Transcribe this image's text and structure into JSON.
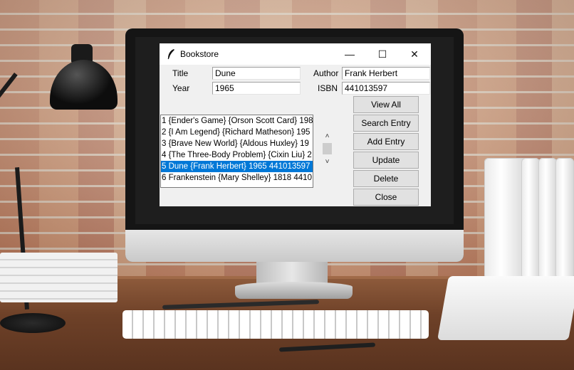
{
  "window": {
    "title": "Bookstore",
    "min_glyph": "—",
    "max_glyph": "☐",
    "close_glyph": "✕"
  },
  "form": {
    "title_label": "Title",
    "title_value": "Dune",
    "author_label": "Author",
    "author_value": "Frank Herbert",
    "year_label": "Year",
    "year_value": "1965",
    "isbn_label": "ISBN",
    "isbn_value": "441013597"
  },
  "list": {
    "items": [
      "1 {Ender's Game} {Orson Scott Card} 198",
      "2 {I Am Legend} {Richard Matheson} 195",
      "3 {Brave New World} {Aldous Huxley} 19",
      "4 {The Three-Body Problem} {Cixin Liu} 2",
      "5 Dune {Frank Herbert} 1965 441013597",
      "6 Frankenstein {Mary Shelley} 1818 4410"
    ],
    "selected_index": 4
  },
  "scrollbar": {
    "up_glyph": "˄",
    "down_glyph": "˅"
  },
  "buttons": {
    "view_all": "View All",
    "search": "Search Entry",
    "add": "Add Entry",
    "update": "Update",
    "delete": "Delete",
    "close": "Close"
  },
  "colors": {
    "selection": "#0078d7",
    "window_bg": "#f0f0f0"
  }
}
